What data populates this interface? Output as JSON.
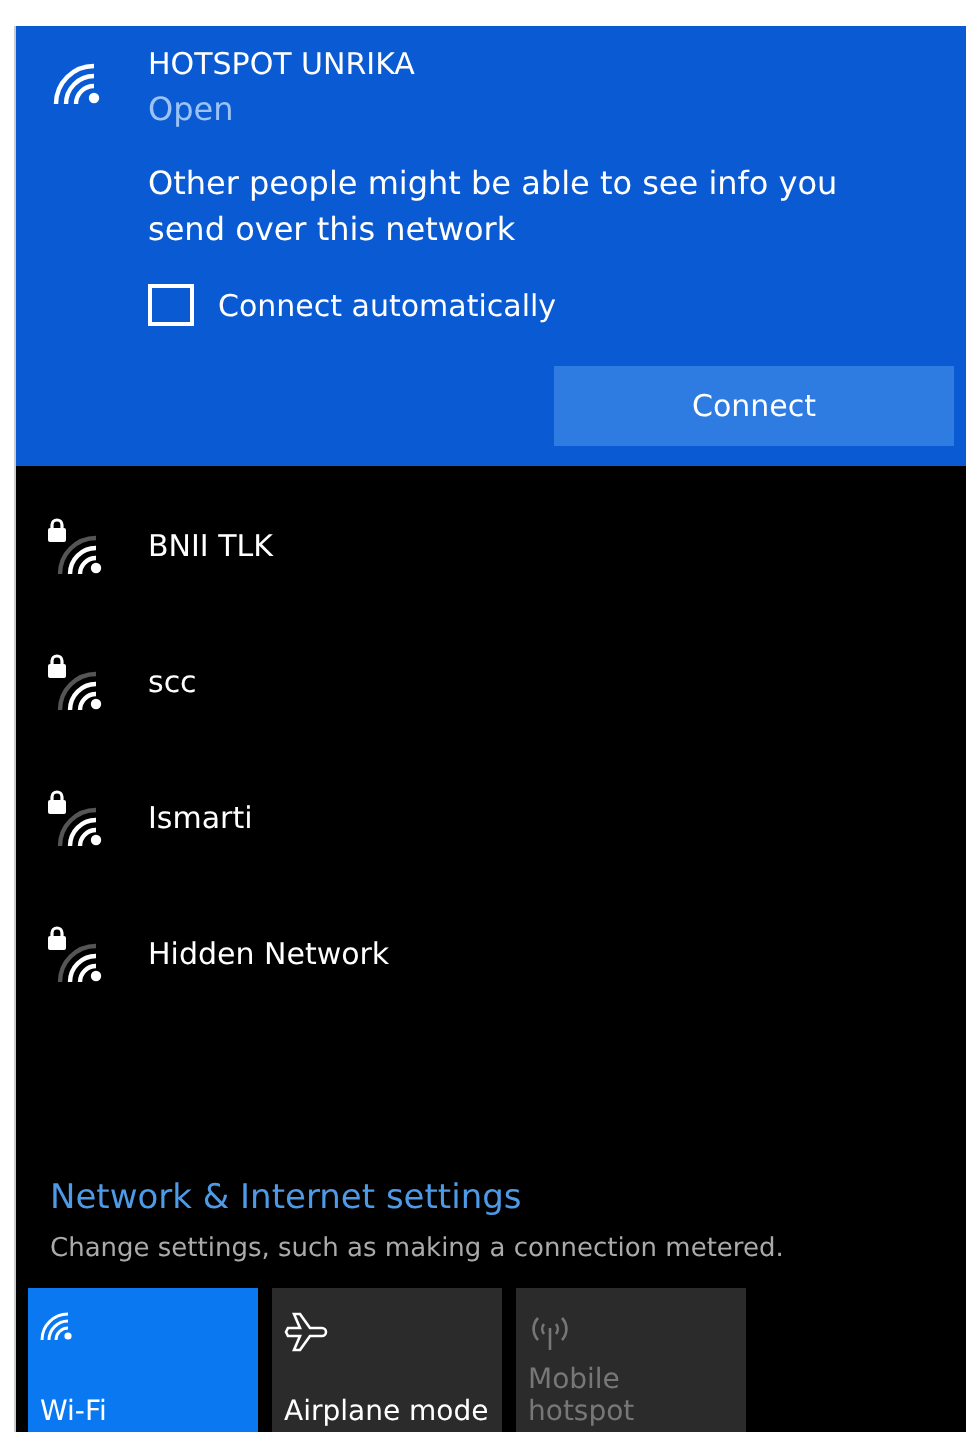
{
  "selected_network": {
    "name": "HOTSPOT UNRIKA",
    "status": "Open",
    "warning": "Other people might be able to see info you send over this network",
    "connect_automatically": {
      "label": "Connect automatically",
      "checked": false
    },
    "connect_button": "Connect"
  },
  "networks": [
    {
      "name": "BNII TLK",
      "secured": true
    },
    {
      "name": "scc",
      "secured": true
    },
    {
      "name": "Ismarti",
      "secured": true
    },
    {
      "name": "Hidden Network",
      "secured": true
    }
  ],
  "settings_link": {
    "title": "Network & Internet settings",
    "description": "Change settings, such as making a connection metered."
  },
  "quick_actions": [
    {
      "kind": "wifi",
      "label": "Wi-Fi",
      "on": true,
      "disabled": false
    },
    {
      "kind": "airplane",
      "label": "Airplane mode",
      "on": false,
      "disabled": false
    },
    {
      "kind": "hotspot",
      "label": "Mobile hotspot",
      "on": false,
      "disabled": true
    }
  ]
}
